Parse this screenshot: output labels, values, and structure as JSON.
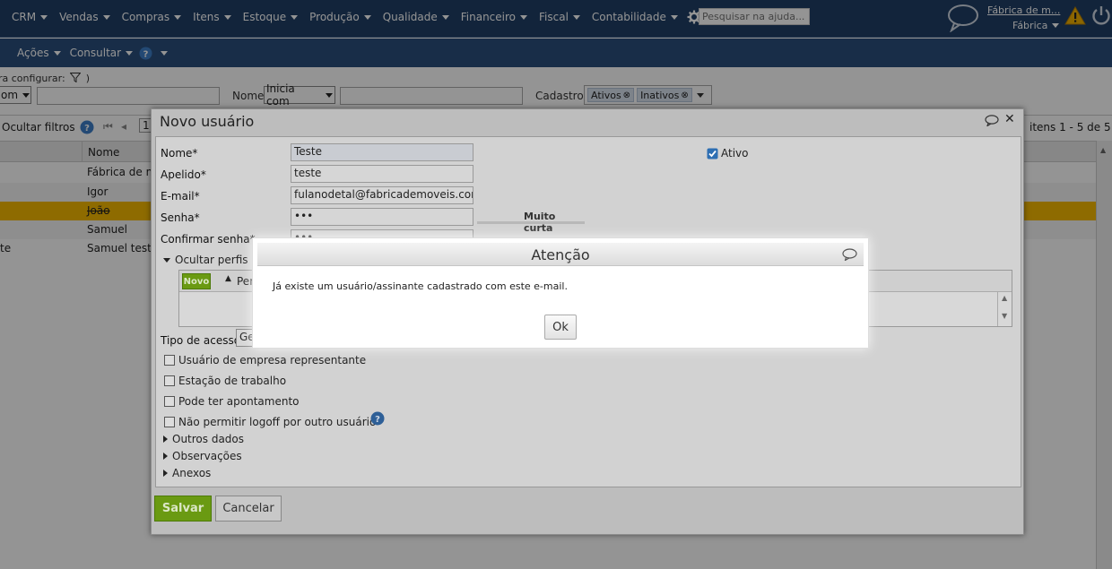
{
  "topnav": {
    "menus": [
      "CRM",
      "Vendas",
      "Compras",
      "Itens",
      "Estoque",
      "Produção",
      "Qualidade",
      "Financeiro",
      "Fiscal",
      "Contabilidade"
    ],
    "search_placeholder": "Pesquisar na ajuda...",
    "company_link": "Fábrica de m...",
    "company_select": "Fábrica"
  },
  "toolbar2": {
    "acoes": "Ações",
    "consultar": "Consultar"
  },
  "filters": {
    "legend": "ra configurar:",
    "legend_close": ")",
    "op1": "om",
    "nome_label": "Nome",
    "nome_op": "Inicia com",
    "cadastro_label": "Cadastro",
    "tags": [
      "Ativos",
      "Inativos"
    ]
  },
  "grid": {
    "hide_filters": "Ocultar filtros",
    "page": "1",
    "items_info": "itens 1 - 5 de 5",
    "col_nome": "Nome",
    "rows": [
      {
        "left": "",
        "nome": "Fábrica de m"
      },
      {
        "left": "",
        "nome": "Igor"
      },
      {
        "left": "",
        "nome": "João"
      },
      {
        "left": "",
        "nome": "Samuel"
      },
      {
        "left": "te",
        "nome": "Samuel teste"
      }
    ]
  },
  "window": {
    "title": "Novo usuário",
    "ativo_label": "Ativo",
    "fields": {
      "nome_label": "Nome*",
      "nome_value": "Teste",
      "apelido_label": "Apelido*",
      "apelido_value": "teste",
      "email_label": "E-mail*",
      "email_value": "fulanodetal@fabricademoveis.com.br",
      "senha_label": "Senha*",
      "senha_value": "•••",
      "strength": "Muito curta",
      "confirmar_label": "Confirmar senha*",
      "confirmar_value": "•••"
    },
    "perfis_label": "Ocultar perfis de",
    "novo_btn": "Novo",
    "perfis_col": "Per",
    "tipo_acesso_label": "Tipo de acesso",
    "tipo_acesso_value": "Ge",
    "checks": [
      "Usuário de empresa representante",
      "Estação de trabalho",
      "Pode ter apontamento",
      "Não permitir logoff por outro usuário"
    ],
    "sections": [
      "Outros dados",
      "Observações",
      "Anexos"
    ],
    "save_btn": "Salvar",
    "cancel_btn": "Cancelar"
  },
  "alert": {
    "title": "Atenção",
    "message": "Já existe um usuário/assinante cadastrado com este e-mail.",
    "ok": "Ok"
  }
}
